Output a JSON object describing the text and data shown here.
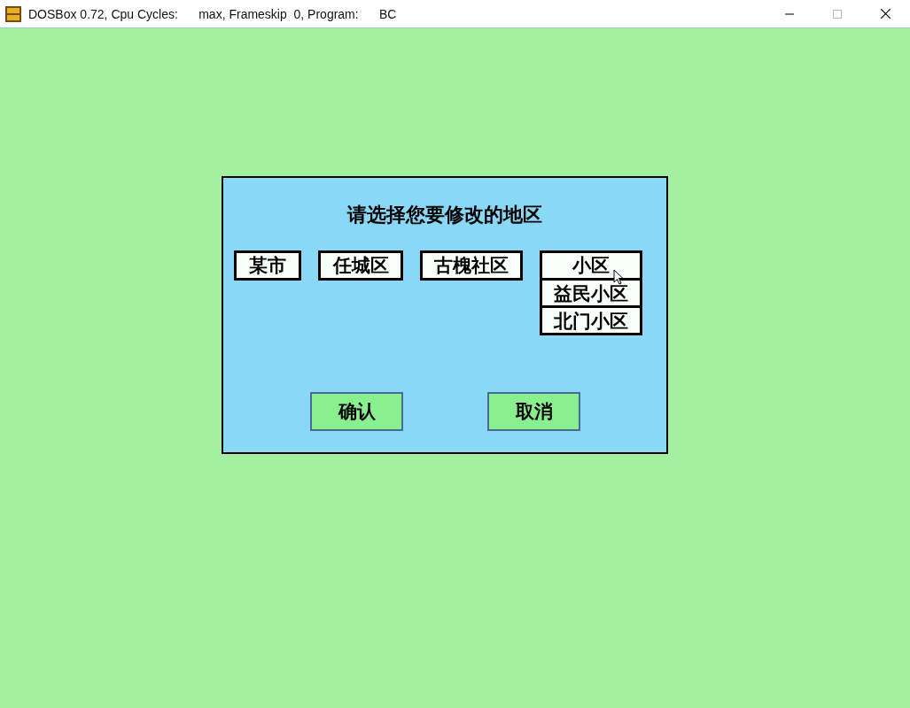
{
  "window": {
    "title": "DOSBox 0.72, Cpu Cycles:      max, Frameskip  0, Program:      BC"
  },
  "dialog": {
    "title": "请选择您要修改的地区",
    "regions": [
      {
        "kind": "button",
        "label": "某市"
      },
      {
        "kind": "button",
        "label": "任城区"
      },
      {
        "kind": "button",
        "label": "古槐社区"
      },
      {
        "kind": "dropdown",
        "label": "小区",
        "expanded": true,
        "options": [
          "益民小区",
          "北门小区"
        ]
      }
    ],
    "buttons": [
      "确认",
      "取消"
    ]
  }
}
